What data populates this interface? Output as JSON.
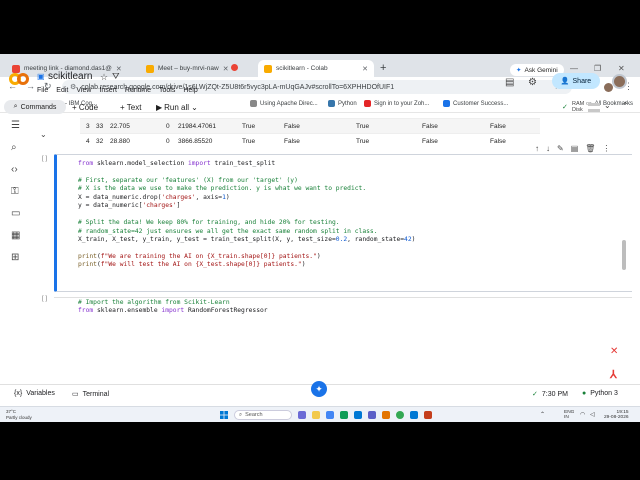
{
  "tabs": [
    {
      "label": "meeting link - diamond.das1@",
      "color": "#ea4335"
    },
    {
      "label": "Meet – buy-mrvi-naw",
      "color": "#f9ab00"
    },
    {
      "label": "scikitlearn - Colab",
      "color": "#f9ab00"
    }
  ],
  "tab_new": "+",
  "ask_gemini": "Ask Gemini",
  "url": "colab.research.google.com/drive/1s6LWjZQt-Z5U8t6r5vyc3pLA-mUqGAJv#scrollTo=6XPHHDOfUIF1",
  "bookmarks": [
    {
      "label": "Interface - IBM Cog...",
      "color": "#0f62fe"
    },
    {
      "label": "Using Apache Direc...",
      "color": "#888888"
    },
    {
      "label": "Python",
      "color": "#3776ab"
    },
    {
      "label": "Sign in to your Zoh...",
      "color": "#e42527"
    },
    {
      "label": "Customer Success...",
      "color": "#1a73e8"
    }
  ],
  "all_bookmarks": "All Bookmarks",
  "notebook_title": "scikitlearn",
  "menu": [
    "File",
    "Edit",
    "View",
    "Insert",
    "Runtime",
    "Tools",
    "Help"
  ],
  "share_label": "Share",
  "toolbar": {
    "commands": "Commands",
    "code": "+ Code",
    "text": "+ Text",
    "run_all": "Run all",
    "ram": "RAM",
    "disk": "Disk"
  },
  "table_rows": [
    [
      "3",
      "33",
      "22.705",
      "0",
      "21984.47061",
      "True",
      "False",
      "True",
      "False",
      "False"
    ],
    [
      "4",
      "32",
      "28.880",
      "0",
      "3866.85520",
      "True",
      "False",
      "True",
      "False",
      "False"
    ]
  ],
  "cell1_bracket": "[ ]",
  "cell2_bracket": "[ ]",
  "code_lines": [
    "from sklearn.model_selection import train_test_split",
    "",
    "# First, separate our 'features' (X) from our 'target' (y)",
    "# X is the data we use to make the prediction. y is what we want to predict.",
    "X = data_numeric.drop('charges', axis=1)",
    "y = data_numeric['charges']",
    "",
    "# Split the data! We keep 80% for training, and hide 20% for testing.",
    "# random_state=42 just ensures we all get the exact same random split in class.",
    "X_train, X_test, y_train, y_test = train_test_split(X, y, test_size=0.2, random_state=42)",
    "",
    "print(f\"We are training the AI on {X_train.shape[0]} patients.\")",
    "print(f\"We will test the AI on {X_test.shape[0]} patients.\")"
  ],
  "code2_lines": [
    "# Import the algorithm from Scikit-Learn",
    "from sklearn.ensemble import RandomForestRegressor"
  ],
  "status": {
    "variables": "Variables",
    "terminal": "Terminal",
    "time": "7:30 PM",
    "runtime": "Python 3"
  },
  "taskbar": {
    "temp": "37°C",
    "weather": "Partly cloudy",
    "search": "Search",
    "lang": "ENG",
    "region": "IN",
    "clock_time": "19:15",
    "clock_date": "29-08-2026"
  },
  "colors": {
    "accent": "#1a73e8",
    "share_bg": "#c2e7ff",
    "colab_orange": "#f9ab00"
  }
}
